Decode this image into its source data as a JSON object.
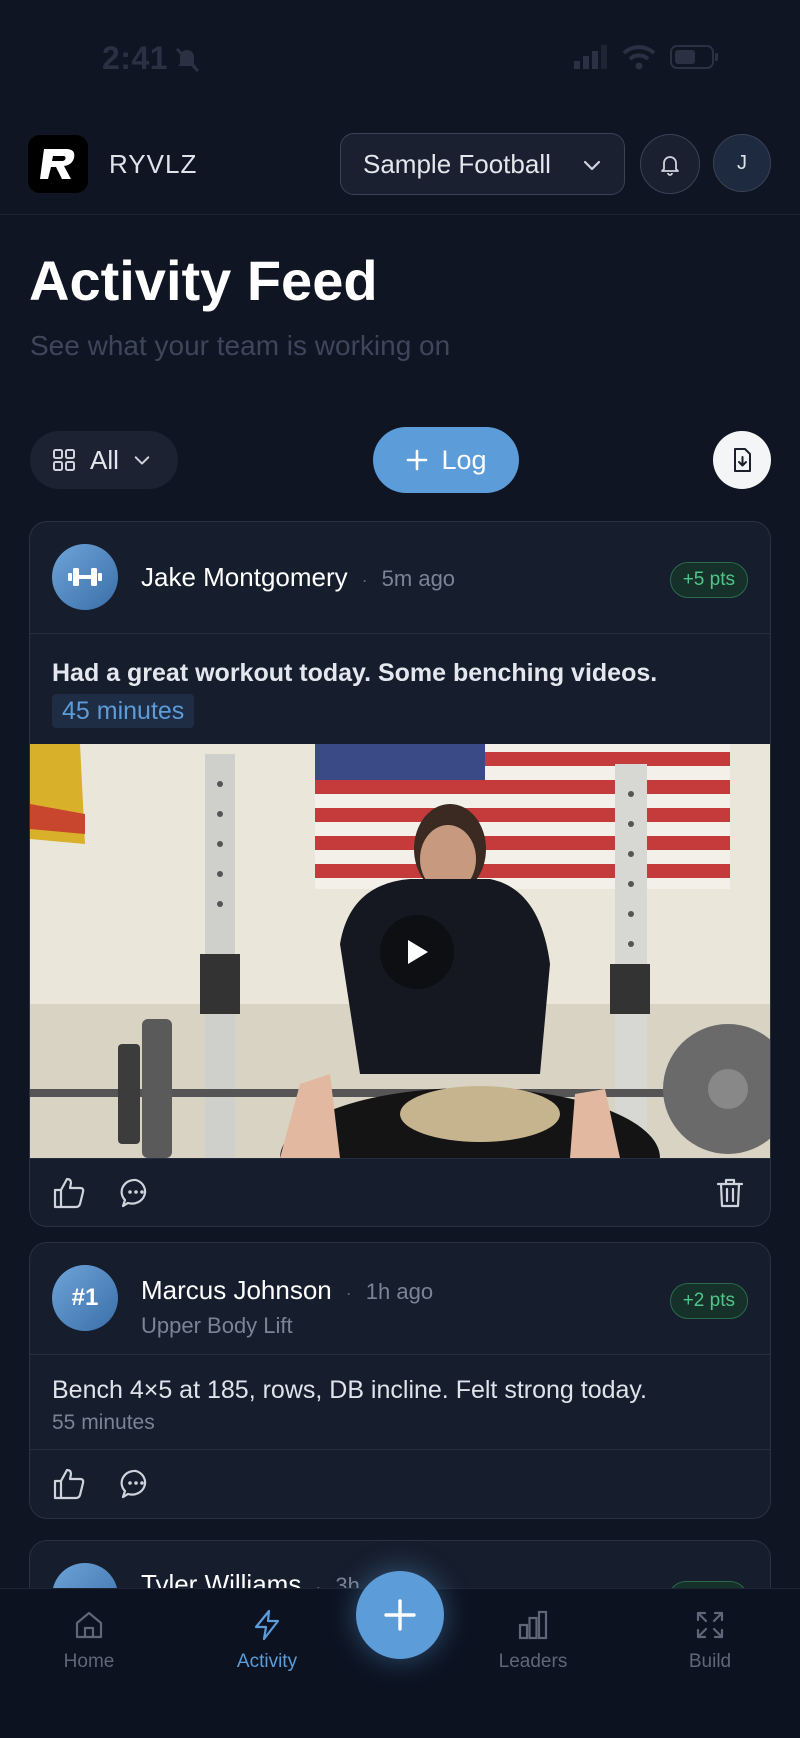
{
  "status_bar": {
    "time": "2:41"
  },
  "header": {
    "brand": "RYVLZ",
    "team_selector": "Sample Football",
    "avatar_initial": "J"
  },
  "page": {
    "title": "Activity Feed",
    "subtitle": "See what your team is working on"
  },
  "toolbar": {
    "filter_label": "All",
    "log_label": "Log"
  },
  "posts": [
    {
      "name": "Jake Montgomery",
      "time": "5m ago",
      "points": "+5 pts",
      "text": "Had a great workout today. Some benching videos.",
      "duration": "45 minutes",
      "avatar_icon": "dumbbell-icon"
    },
    {
      "name": "Marcus Johnson",
      "time": "1h ago",
      "category": "Upper Body Lift",
      "points": "+2 pts",
      "avatar_label": "#1",
      "text": "Bench 4×5 at 185, rows, DB incline. Felt strong today.",
      "duration": "55 minutes"
    },
    {
      "name": "Tyler Williams",
      "time": "3h"
    }
  ],
  "bottom_nav": {
    "items": [
      {
        "label": "Home",
        "icon": "home-icon"
      },
      {
        "label": "Activity",
        "icon": "lightning-icon",
        "active": true
      },
      {
        "label": "Leaders",
        "icon": "bar-chart-icon"
      },
      {
        "label": "Build",
        "icon": "expand-icon"
      }
    ]
  },
  "colors": {
    "background": "#0f1523",
    "accent": "#5b9cd9",
    "points_green": "#4fc58a",
    "card": "#161d2c"
  }
}
